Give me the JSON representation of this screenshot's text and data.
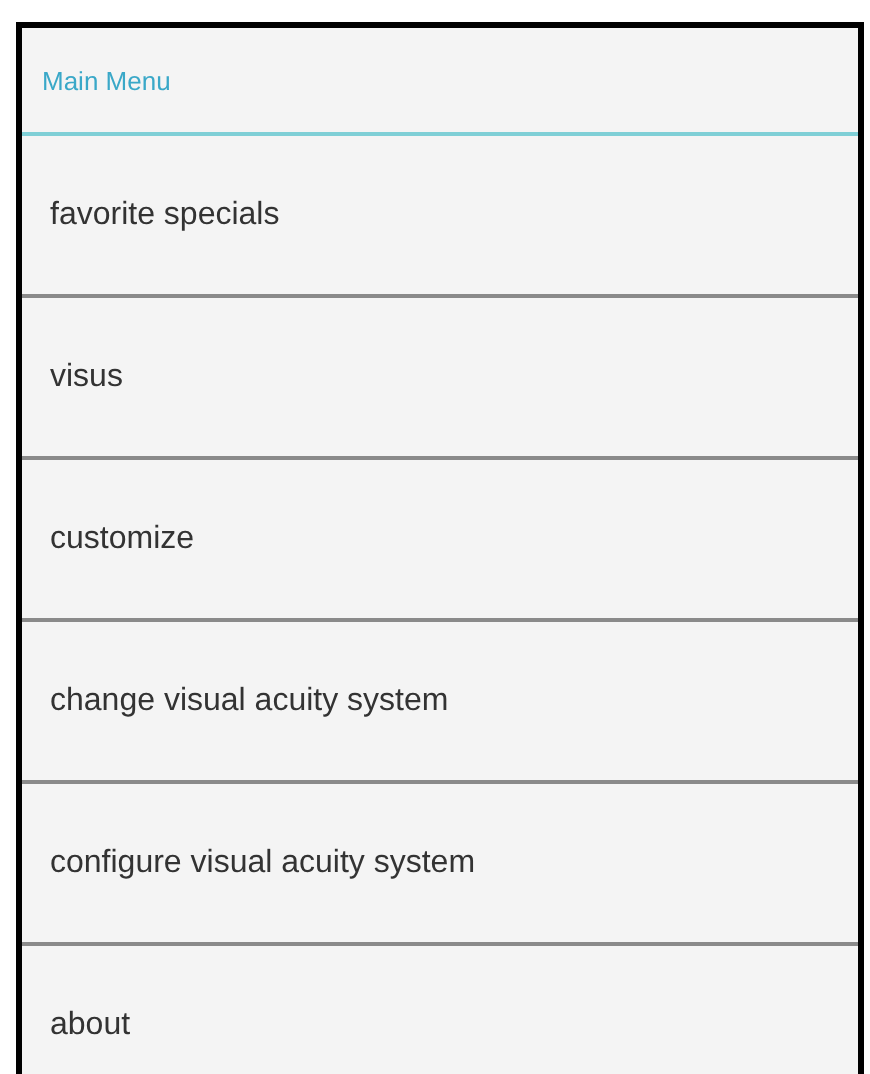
{
  "title": "Main Menu",
  "items": [
    {
      "label": "favorite specials"
    },
    {
      "label": "visus"
    },
    {
      "label": "customize"
    },
    {
      "label": "change visual acuity system"
    },
    {
      "label": "configure visual acuity system"
    },
    {
      "label": "about"
    }
  ]
}
